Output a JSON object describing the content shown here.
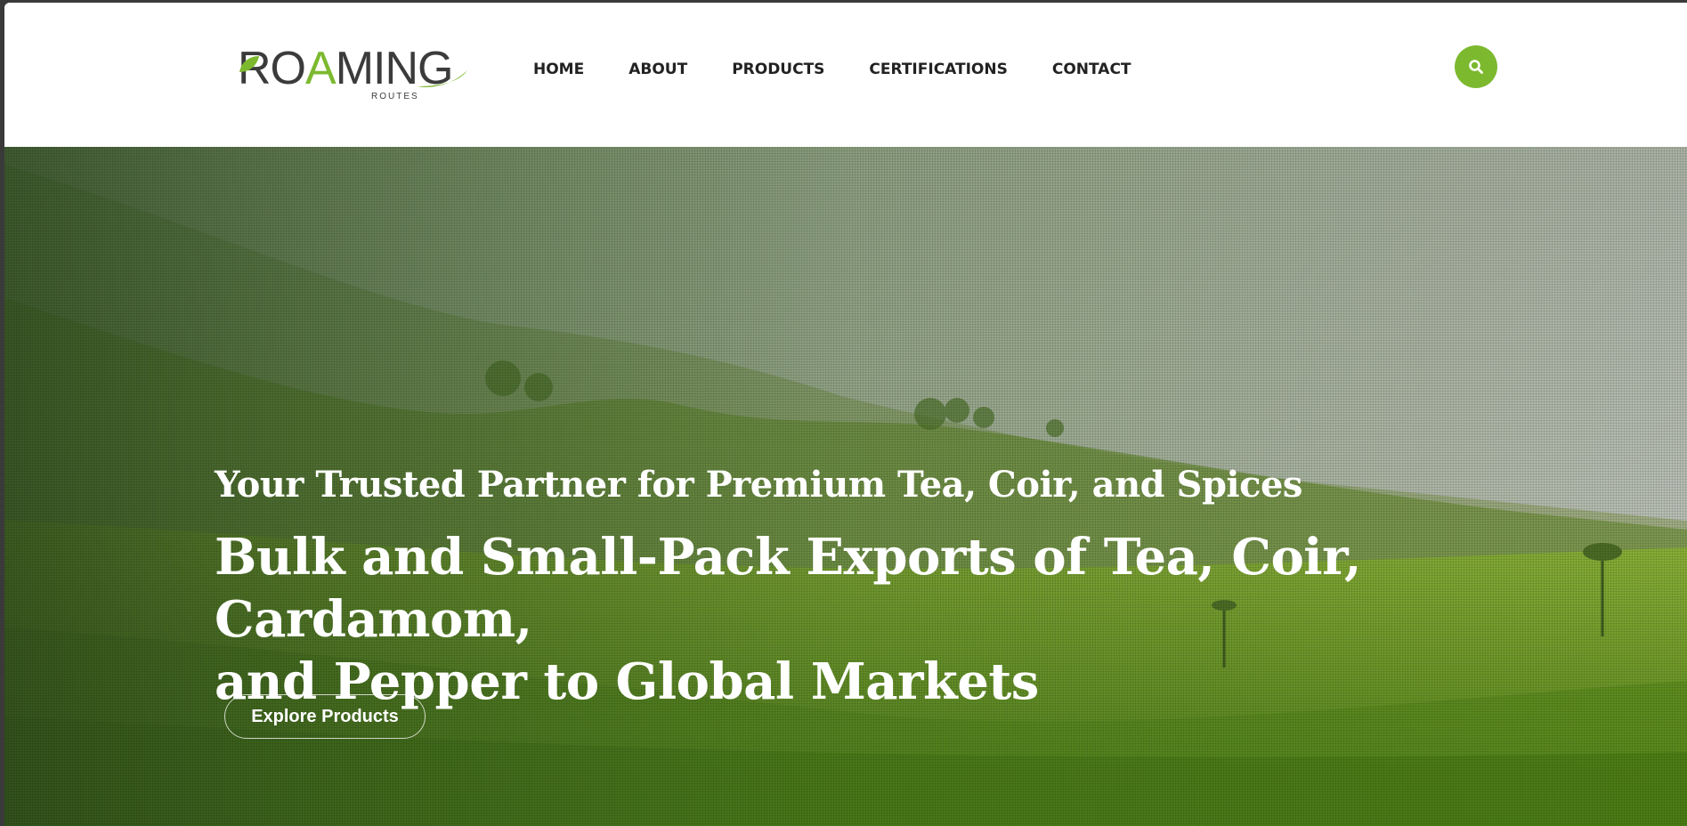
{
  "header": {
    "logo": {
      "word_prefix": "RO",
      "word_accent": "A",
      "word_suffix": "MING",
      "tagline": "ROUTES"
    },
    "nav": [
      "HOME",
      "ABOUT",
      "PRODUCTS",
      "CERTIFICATIONS",
      "CONTACT"
    ],
    "search_icon": "search-icon"
  },
  "hero": {
    "subtitle": "Your Trusted Partner for Premium Tea, Coir, and Spices",
    "title_line1": "Bulk and Small-Pack Exports of Tea, Coir, Cardamom,",
    "title_line2": "and Pepper to Global Markets",
    "cta_label": "Explore Products",
    "background": "tea-plantation-hills-image"
  },
  "colors": {
    "accent": "#7cb92f",
    "nav_text": "#222222",
    "hero_text": "#ffffff"
  }
}
